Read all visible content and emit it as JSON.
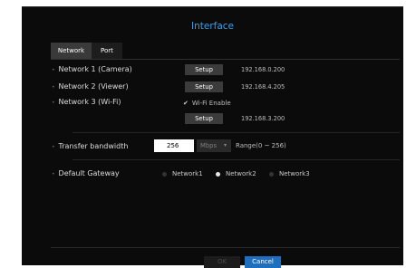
{
  "window": {
    "title": "Interface"
  },
  "tabs": [
    {
      "label": "Network",
      "active": true
    },
    {
      "label": "Port",
      "active": false
    }
  ],
  "networks": [
    {
      "label": "Network 1 (Camera)",
      "button": "Setup",
      "ip": "192.168.0.200"
    },
    {
      "label": "Network 2 (Viewer)",
      "button": "Setup",
      "ip": "192.168.4.205"
    },
    {
      "label": "Network 3 (Wi-Fi)",
      "checkbox_label": "Wi-Fi Enable",
      "checked": true,
      "button": "Setup",
      "ip": "192.168.3.200"
    }
  ],
  "bandwidth": {
    "label": "Transfer bandwidth",
    "value": "256",
    "unit": "Mbps",
    "range": "Range(0 ~ 256)"
  },
  "gateway": {
    "label": "Default Gateway",
    "options": [
      "Network1",
      "Network2",
      "Network3"
    ],
    "selected": "Network2"
  },
  "footer": {
    "ok": "OK",
    "cancel": "Cancel"
  },
  "colors": {
    "accent": "#3f9de4",
    "primary_button": "#1e6fbd",
    "background": "#0b0b0b"
  }
}
